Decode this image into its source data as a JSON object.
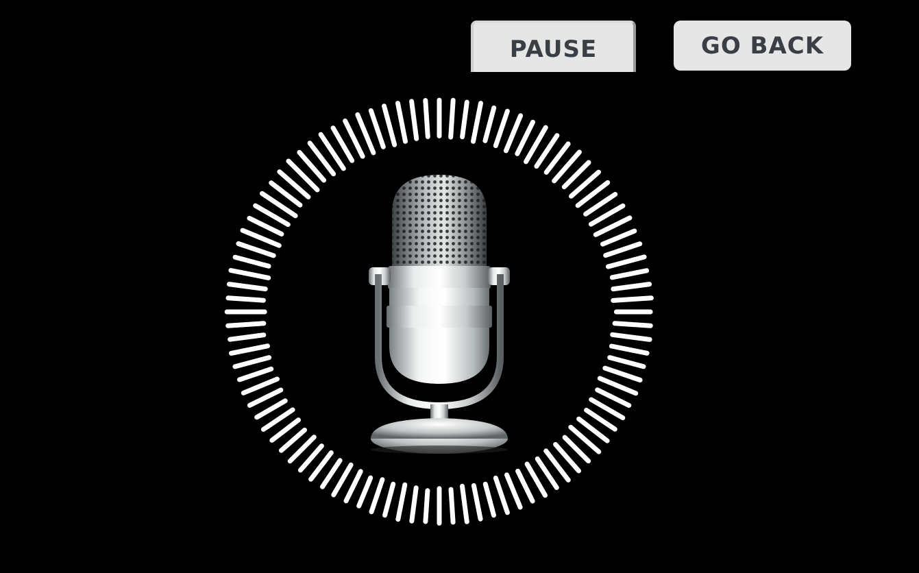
{
  "controls": {
    "pause_label": "PAUSE",
    "go_back_label": "GO BACK"
  },
  "visualizer": {
    "bar_color": "#ffffff",
    "bar_count": 96,
    "levels": [
      0.78,
      0.82,
      0.75,
      0.88,
      0.72,
      0.8,
      0.85,
      0.76,
      0.9,
      0.82,
      0.78,
      0.86,
      0.74,
      0.8,
      0.84,
      0.77,
      0.81,
      0.85,
      0.73,
      0.79,
      0.83,
      0.76,
      0.8,
      0.86,
      0.72,
      0.78,
      0.84,
      0.79,
      0.75,
      0.82,
      0.88,
      0.76,
      0.8,
      0.73,
      0.78,
      0.83,
      0.7,
      0.76,
      0.81,
      0.74,
      0.79,
      0.7,
      0.75,
      0.8,
      0.66,
      0.72,
      0.78,
      0.68,
      0.74,
      0.62,
      0.7,
      0.76,
      0.66,
      0.72,
      0.6,
      0.68,
      0.74,
      0.64,
      0.7,
      0.66,
      0.72,
      0.62,
      0.7,
      0.76,
      0.68,
      0.74,
      0.8,
      0.7,
      0.76,
      0.82,
      0.72,
      0.78,
      0.84,
      0.76,
      0.8,
      0.86,
      0.74,
      0.82,
      0.9,
      0.78,
      0.84,
      0.92,
      0.8,
      0.86,
      0.94,
      0.82,
      0.88,
      0.95,
      0.84,
      0.9,
      0.96,
      0.86,
      0.92,
      0.88,
      0.84,
      0.8
    ]
  },
  "icon": {
    "name": "microphone-icon",
    "metal_light": "#f2f4f4",
    "metal_dark": "#5e6466"
  }
}
